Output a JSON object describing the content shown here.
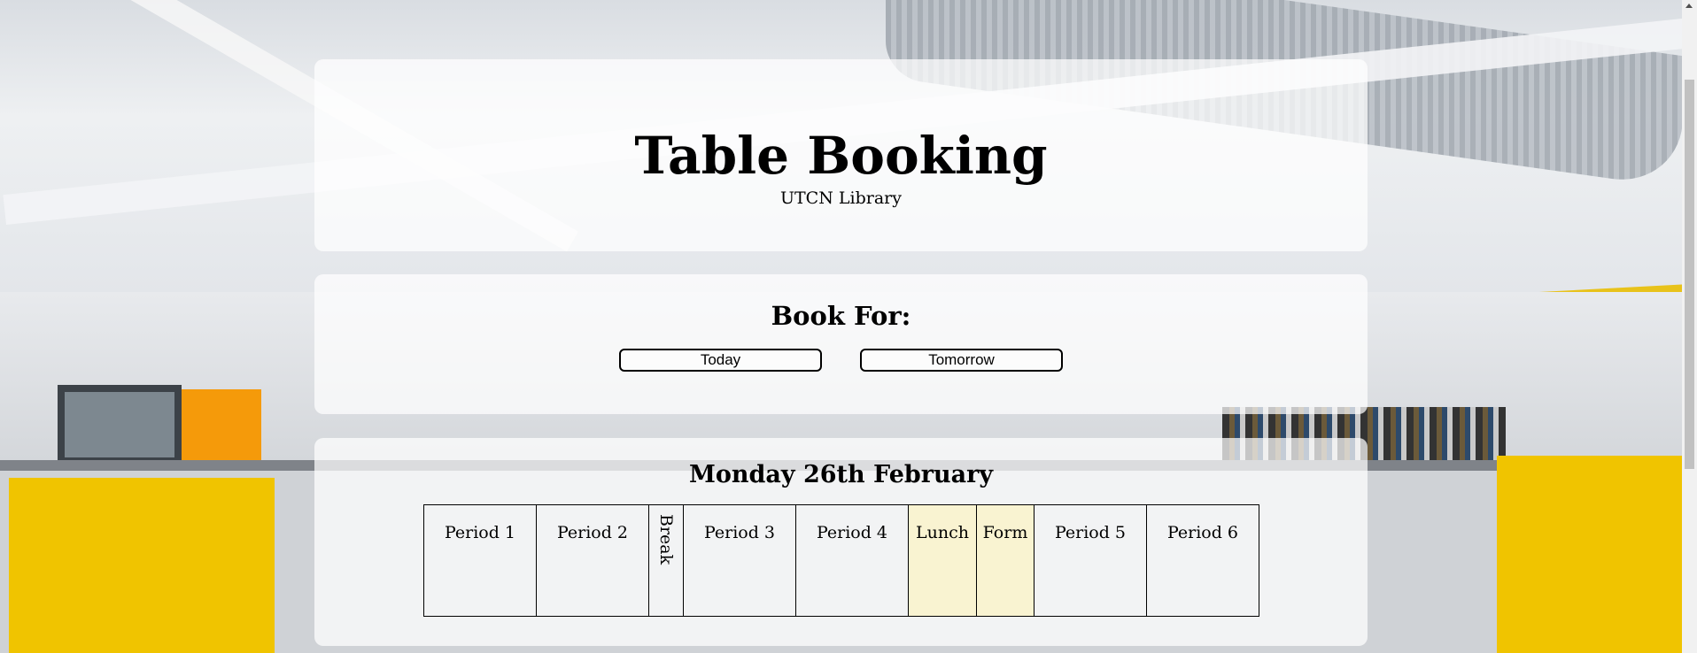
{
  "header": {
    "title": "Table Booking",
    "subtitle": "UTCN Library"
  },
  "booking": {
    "heading": "Book For:",
    "buttons": [
      "Today",
      "Tomorrow"
    ]
  },
  "timetable": {
    "date": "Monday 26th February",
    "periods": [
      "Period 1",
      "Period 2",
      "Break",
      "Period 3",
      "Period 4",
      "Lunch",
      "Form",
      "Period 5",
      "Period 6"
    ]
  }
}
